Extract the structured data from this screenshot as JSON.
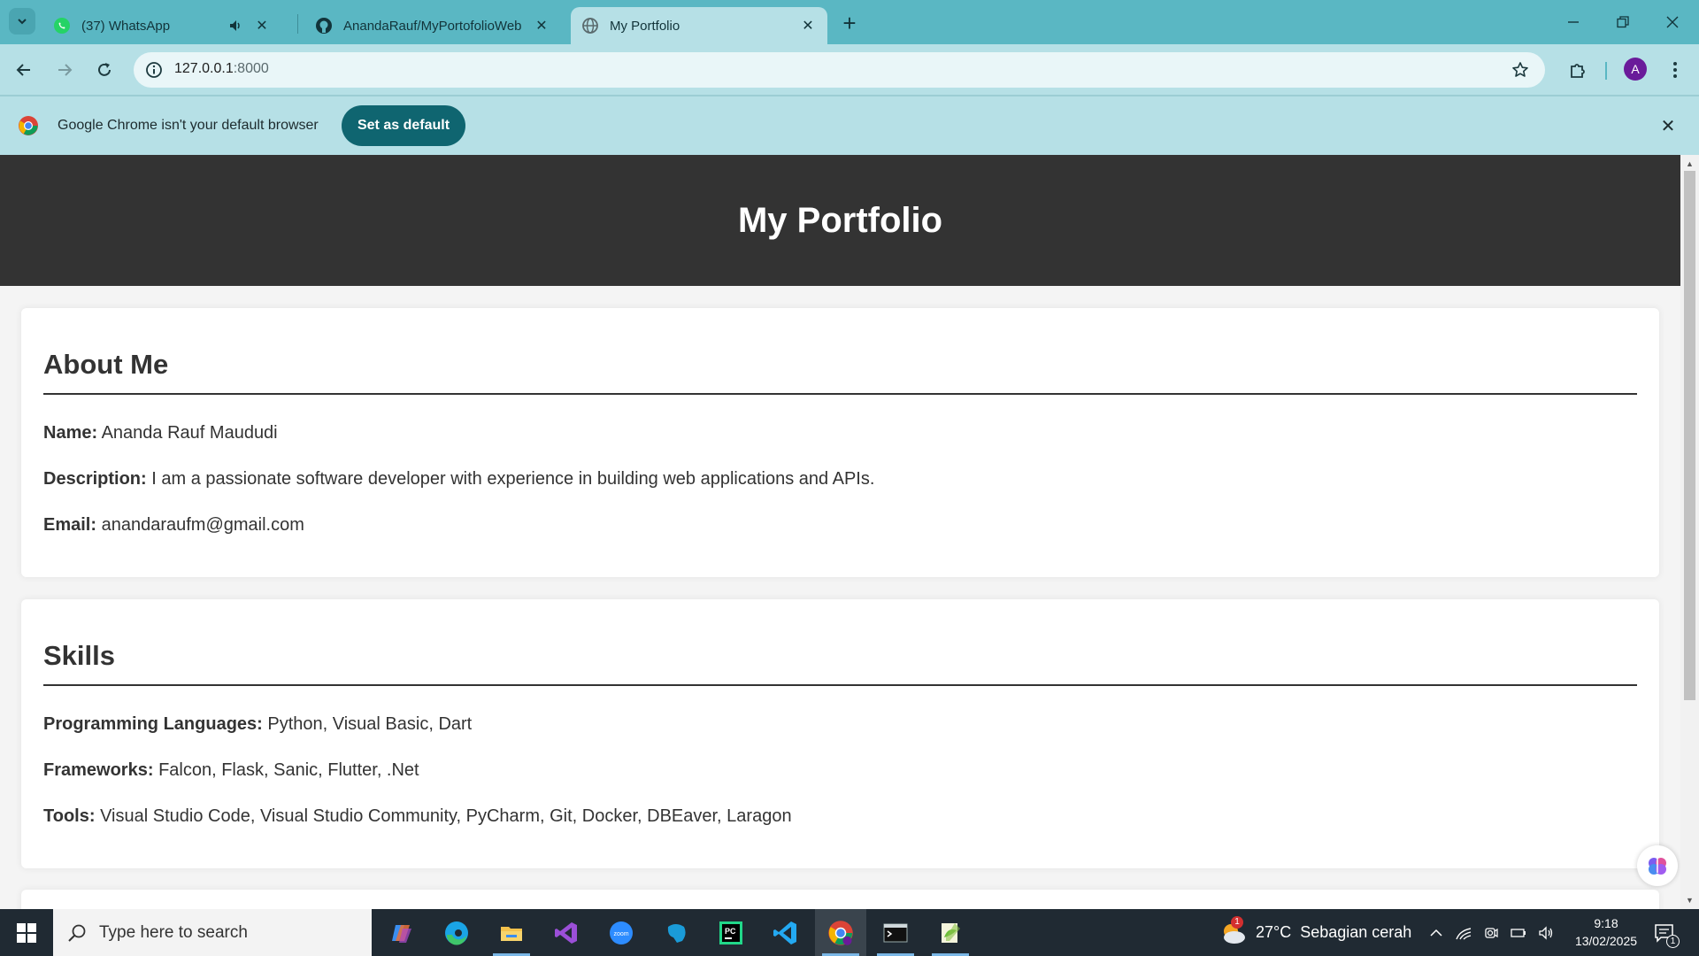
{
  "browser": {
    "tabs": [
      {
        "title": "(37) WhatsApp",
        "icon": "whatsapp-icon",
        "audio": true
      },
      {
        "title": "AnandaRauf/MyPortofolioWeb",
        "icon": "github-icon"
      },
      {
        "title": "My Portfolio",
        "icon": "globe-icon",
        "active": true
      }
    ],
    "url_host": "127.0.0.1",
    "url_port": ":8000",
    "profile_initial": "A",
    "accent": "#5ab7c3"
  },
  "infobar": {
    "message": "Google Chrome isn't your default browser",
    "button": "Set as default"
  },
  "page": {
    "header_title": "My Portfolio",
    "about": {
      "heading": "About Me",
      "name_label": "Name:",
      "name_value": "Ananda Rauf Maududi",
      "desc_label": "Description:",
      "desc_value": "I am a passionate software developer with experience in building web applications and APIs.",
      "email_label": "Email:",
      "email_value": "anandaraufm@gmail.com"
    },
    "skills": {
      "heading": "Skills",
      "lang_label": "Programming Languages:",
      "lang_value": "Python, Visual Basic, Dart",
      "fw_label": "Frameworks:",
      "fw_value": "Falcon, Flask, Sanic, Flutter, .Net",
      "tools_label": "Tools:",
      "tools_value": "Visual Studio Code, Visual Studio Community, PyCharm, Git, Docker, DBEaver, Laragon"
    }
  },
  "taskbar": {
    "search_placeholder": "Type here to search",
    "weather": "27°C  Sebagian cerah",
    "weather_badge": "1",
    "time": "9:18",
    "date": "13/02/2025",
    "notification_count": "1",
    "apps": [
      "copilot-icon",
      "edge-icon",
      "file-explorer-icon",
      "visual-studio-icon",
      "zoom-icon",
      "mysql-workbench-icon",
      "pycharm-icon",
      "vscode-icon",
      "chrome-icon",
      "terminal-icon",
      "notepad-plus-icon"
    ]
  }
}
